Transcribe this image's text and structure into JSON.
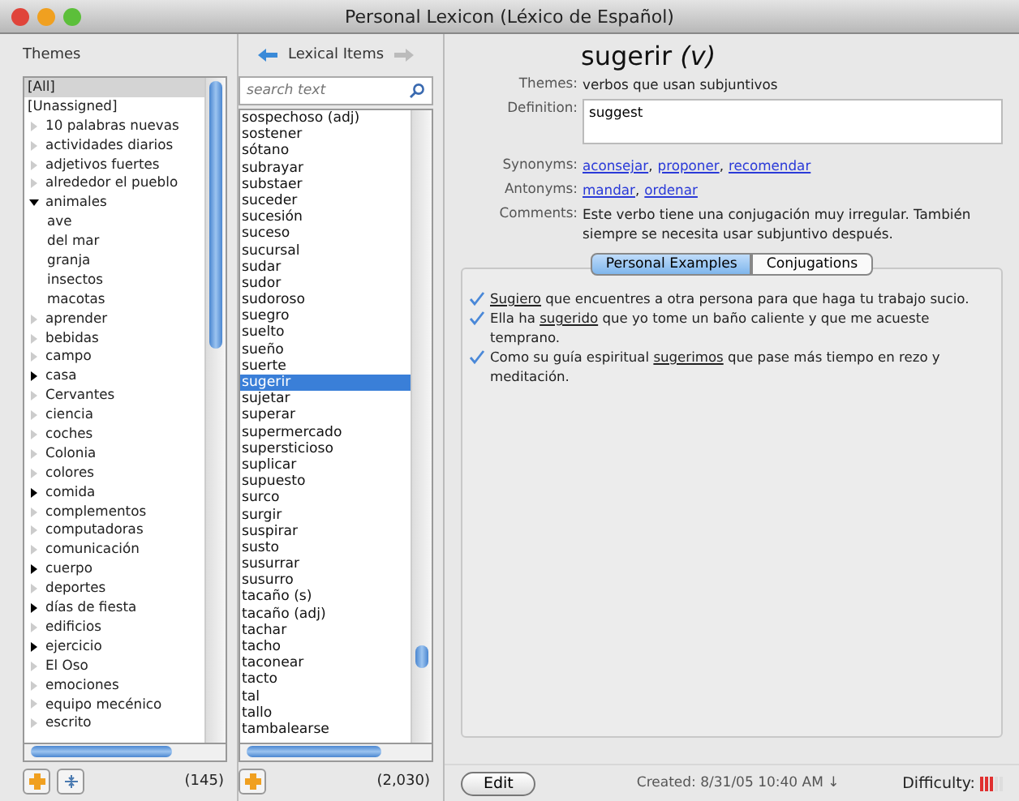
{
  "window": {
    "title": "Personal Lexicon (Léxico de Español)"
  },
  "themes": {
    "header": "Themes",
    "count": "(145)",
    "items": [
      {
        "label": "[All]",
        "kind": "special",
        "selected": true
      },
      {
        "label": "[Unassigned]",
        "kind": "special",
        "selected": false
      },
      {
        "label": "10 palabras nuevas",
        "kind": "empty",
        "selected": false
      },
      {
        "label": "actividades diarios",
        "kind": "empty",
        "selected": false
      },
      {
        "label": "adjetivos fuertes",
        "kind": "empty",
        "selected": false
      },
      {
        "label": "alrededor el pueblo",
        "kind": "empty",
        "selected": false
      },
      {
        "label": "animales",
        "kind": "folder",
        "expanded": true,
        "selected": false,
        "children": [
          {
            "label": "ave",
            "kind": "leaf",
            "selected": false
          },
          {
            "label": "del mar",
            "kind": "leaf",
            "selected": false
          },
          {
            "label": "granja",
            "kind": "leaf",
            "selected": false
          },
          {
            "label": "insectos",
            "kind": "leaf",
            "selected": false
          },
          {
            "label": "macotas",
            "kind": "leaf",
            "selected": false
          }
        ]
      },
      {
        "label": "aprender",
        "kind": "empty",
        "selected": false
      },
      {
        "label": "bebidas",
        "kind": "empty",
        "selected": false
      },
      {
        "label": "campo",
        "kind": "empty",
        "selected": false
      },
      {
        "label": "casa",
        "kind": "folder",
        "expanded": false,
        "selected": false
      },
      {
        "label": "Cervantes",
        "kind": "empty",
        "selected": false
      },
      {
        "label": "ciencia",
        "kind": "empty",
        "selected": false
      },
      {
        "label": "coches",
        "kind": "empty",
        "selected": false
      },
      {
        "label": "Colonia",
        "kind": "empty",
        "selected": false
      },
      {
        "label": "colores",
        "kind": "empty",
        "selected": false
      },
      {
        "label": "comida",
        "kind": "folder",
        "expanded": false,
        "selected": false
      },
      {
        "label": "complementos",
        "kind": "empty",
        "selected": false
      },
      {
        "label": "computadoras",
        "kind": "empty",
        "selected": false
      },
      {
        "label": "comunicación",
        "kind": "empty",
        "selected": false
      },
      {
        "label": "cuerpo",
        "kind": "folder",
        "expanded": false,
        "selected": false
      },
      {
        "label": "deportes",
        "kind": "empty",
        "selected": false
      },
      {
        "label": "días de fiesta",
        "kind": "folder",
        "expanded": false,
        "selected": false
      },
      {
        "label": "edificios",
        "kind": "empty",
        "selected": false
      },
      {
        "label": "ejercicio",
        "kind": "folder",
        "expanded": false,
        "selected": false
      },
      {
        "label": "El Oso",
        "kind": "empty",
        "selected": false
      },
      {
        "label": "emociones",
        "kind": "empty",
        "selected": false
      },
      {
        "label": "equipo mecénico",
        "kind": "empty",
        "selected": false
      },
      {
        "label": "escrito",
        "kind": "empty",
        "selected": false
      }
    ]
  },
  "lexical": {
    "header": "Lexical Items",
    "search": {
      "placeholder": "search text"
    },
    "count": "(2,030)",
    "items": [
      {
        "label": "sospechoso (adj)",
        "selected": false
      },
      {
        "label": "sostener",
        "selected": false
      },
      {
        "label": "sótano",
        "selected": false
      },
      {
        "label": "subrayar",
        "selected": false
      },
      {
        "label": "substaer",
        "selected": false
      },
      {
        "label": "suceder",
        "selected": false
      },
      {
        "label": "sucesión",
        "selected": false
      },
      {
        "label": "suceso",
        "selected": false
      },
      {
        "label": "sucursal",
        "selected": false
      },
      {
        "label": "sudar",
        "selected": false
      },
      {
        "label": "sudor",
        "selected": false
      },
      {
        "label": "sudoroso",
        "selected": false
      },
      {
        "label": "suegro",
        "selected": false
      },
      {
        "label": "suelto",
        "selected": false
      },
      {
        "label": "sueño",
        "selected": false
      },
      {
        "label": "suerte",
        "selected": false
      },
      {
        "label": "sugerir",
        "selected": true
      },
      {
        "label": "sujetar",
        "selected": false
      },
      {
        "label": "superar",
        "selected": false
      },
      {
        "label": "supermercado",
        "selected": false
      },
      {
        "label": "supersticioso",
        "selected": false
      },
      {
        "label": "suplicar",
        "selected": false
      },
      {
        "label": "supuesto",
        "selected": false
      },
      {
        "label": "surco",
        "selected": false
      },
      {
        "label": "surgir",
        "selected": false
      },
      {
        "label": "suspirar",
        "selected": false
      },
      {
        "label": "susto",
        "selected": false
      },
      {
        "label": "susurrar",
        "selected": false
      },
      {
        "label": "susurro",
        "selected": false
      },
      {
        "label": "tacaño (s)",
        "selected": false
      },
      {
        "label": "tacaño (adj)",
        "selected": false
      },
      {
        "label": "tachar",
        "selected": false
      },
      {
        "label": "tacho",
        "selected": false
      },
      {
        "label": "taconear",
        "selected": false
      },
      {
        "label": "tacto",
        "selected": false
      },
      {
        "label": "tal",
        "selected": false
      },
      {
        "label": "tallo",
        "selected": false
      },
      {
        "label": "tambalearse",
        "selected": false
      }
    ]
  },
  "detail": {
    "word": "sugerir",
    "pos": "(v)",
    "themes_label": "Themes:",
    "themes": "verbos que usan subjuntivos",
    "definition_label": "Definition:",
    "definition": "suggest",
    "synonyms_label": "Synonyms:",
    "synonyms": [
      "aconsejar",
      "proponer",
      "recomendar"
    ],
    "separator": ",",
    "antonyms_label": "Antonyms:",
    "antonyms": [
      "mandar",
      "ordenar"
    ],
    "comments_label": "Comments:",
    "comments": "Este verbo tiene una conjugación muy irregular.  También siempre se necesita usar subjuntivo después.",
    "tabs": [
      {
        "label": "Personal Examples",
        "selected": true
      },
      {
        "label": "Conjugations",
        "selected": false
      }
    ],
    "examples": [
      {
        "word": "Sugiero",
        "after": " que encuentres a otra persona para que haga tu trabajo sucio.",
        "checked": true
      },
      {
        "before": "Ella ha ",
        "word": "sugerido",
        "after": " que yo tome un baño caliente y que me acueste temprano.",
        "checked": true
      },
      {
        "before": "Como su guía espiritual ",
        "word": "sugerimos",
        "after": " que pase más tiempo en rezo y meditación.",
        "checked": true
      }
    ]
  },
  "footer": {
    "edit": "Edit",
    "created": "Created: 8/31/05 10:40 AM ↓",
    "difficulty_label": "Difficulty:",
    "difficulty": {
      "level": 0.6
    }
  }
}
